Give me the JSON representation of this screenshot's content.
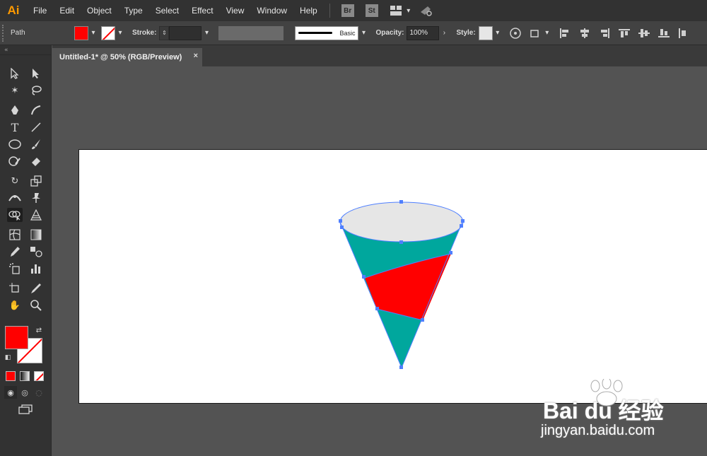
{
  "app": {
    "logo": "Ai"
  },
  "menu": [
    "File",
    "Edit",
    "Object",
    "Type",
    "Select",
    "Effect",
    "View",
    "Window",
    "Help"
  ],
  "bridge": {
    "br": "Br",
    "st": "St"
  },
  "control": {
    "selection_label": "Path",
    "stroke_label": "Stroke:",
    "stroke_value": "",
    "brush_label": "Basic",
    "opacity_label": "Opacity:",
    "opacity_value": "100%",
    "style_label": "Style:"
  },
  "document": {
    "tab_title": "Untitled-1* @ 50% (RGB/Preview)",
    "close": "×"
  },
  "colors": {
    "fill": "#ff0000",
    "cone_body": "#00a79d",
    "cone_band": "#ff0000",
    "cone_top": "#e6e6e6",
    "selection": "#4f7fff"
  },
  "watermark": {
    "brand": "Bai du 经验",
    "url": "jingyan.baidu.com"
  }
}
